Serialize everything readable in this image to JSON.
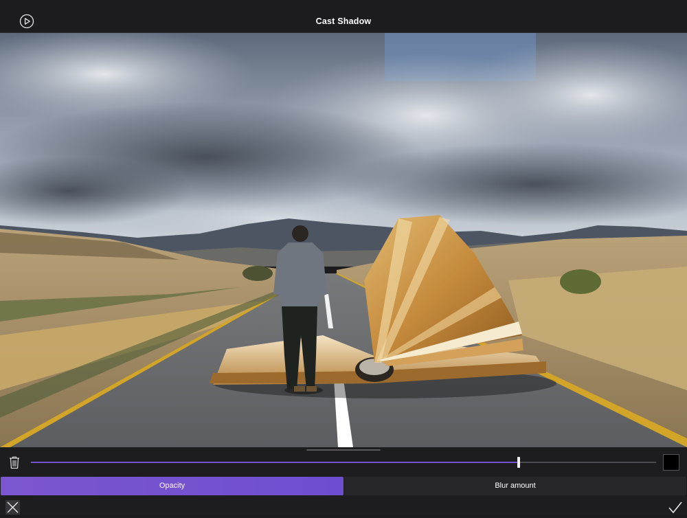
{
  "header": {
    "title": "Cast Shadow",
    "play_icon": "play-circle-icon"
  },
  "editor": {
    "opacity_value": 0.78,
    "shadow_color": "#000000",
    "accent_color": "#7452cf",
    "tabs": [
      {
        "label": "Opacity",
        "active": true
      },
      {
        "label": "Blur amount",
        "active": false
      }
    ]
  },
  "icons": {
    "delete": "trash-icon",
    "cancel": "close-icon",
    "confirm": "checkmark-icon"
  }
}
